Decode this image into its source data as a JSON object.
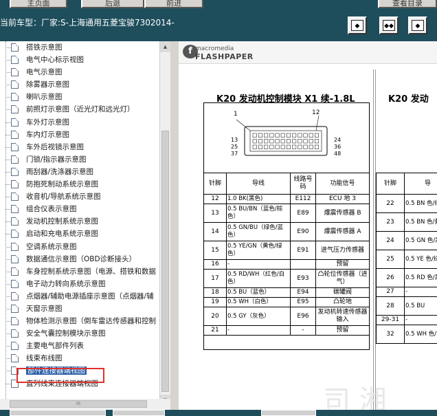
{
  "top_buttons": [
    "主页面",
    "后退",
    "前进",
    "查看目录"
  ],
  "car_model": "当前车型：厂家:S-上海通用五菱宝骏7302014-",
  "nav_buttons": [
    {
      "name": "single-page-icon",
      "glyph": "◆"
    },
    {
      "name": "fit-width-icon",
      "glyph": "◆◆"
    },
    {
      "name": "fit-page-icon",
      "glyph": "◆"
    }
  ],
  "tree": {
    "items": [
      "搭铁示意图",
      "电气中心标示视图",
      "电气示意图",
      "除雾器示意图",
      "喇叭示意图",
      "前照灯示意图（近光灯和远光灯）",
      "车外灯示意图",
      "车内灯示意图",
      "车外后视镜示意图",
      "门锁/指示器示意图",
      "雨刮器/洗涤器示意图",
      "防抱死制动系统示意图",
      "收音机/导航系统示意图",
      "组合仪表示意图",
      "发动机控制系统示意图",
      "启动和充电系统示意图",
      "空调系统示意图",
      "数据通信示意图（OBD诊断接头）",
      "车身控制系统示意图（电源、搭铁和数据",
      "电子动力转向系统示意图",
      "点烟器/辅助电源插座示意图（点烟器/辅",
      "天窗示意图",
      "物体检测示意图（倒车雷达传感器和控制",
      "安全气囊控制模块示意图",
      "主要电气部件列表",
      "线束布线图",
      "部件连接器端视图",
      "直列线束连接器端视图"
    ],
    "selected_index": 26
  },
  "flash": {
    "brand_top": "macromedia",
    "brand_bottom": "FLASHPAPER"
  },
  "doc": {
    "title_left": "K20 发动机控制模块 X1 续-1.8L",
    "title_right": "K20 发动",
    "connector_pins": {
      "top_left": "1",
      "top_right": "12",
      "left": [
        "13",
        "25",
        "37"
      ],
      "right": [
        "24",
        "36",
        "48"
      ]
    },
    "table_headers": [
      "针脚",
      "导线",
      "线路号码",
      "功能信号"
    ],
    "rows": [
      [
        "12",
        "1.0 BK(黑色)",
        "E112",
        "ECU 地 3"
      ],
      [
        "13",
        "0.5 BU/BN（蓝色/棕色）",
        "E89",
        "爆震传感器 B"
      ],
      [
        "14",
        "0.5 GN/BU（绿色/蓝色）",
        "E90",
        "爆震传感器 A"
      ],
      [
        "15",
        "0.5 YE/GN（黄色/绿色）",
        "E91",
        "进气压力传感器"
      ],
      [
        "16",
        "-",
        "",
        "预留"
      ],
      [
        "17",
        "0.5 RD/WH（红色/白色）",
        "E93",
        "凸轮位传感器（进气）"
      ],
      [
        "18",
        "0.5 BU（蓝色）",
        "E94",
        "碳罐阀"
      ],
      [
        "19",
        "0.5 WH（白色）",
        "E95",
        "凸轮地"
      ],
      [
        "20",
        "0.5 GY（灰色）",
        "E96",
        "发动机转速传感器输入"
      ],
      [
        "21",
        "-",
        "-",
        "预留"
      ]
    ],
    "right_headers": [
      "针脚",
      "导"
    ],
    "right_rows": [
      [
        "22",
        "0.5 BN 色/绿"
      ],
      [
        "23",
        "0.5 BN 色/黄"
      ],
      [
        "24",
        "0.5 GN 色/黑"
      ],
      [
        "25",
        "0.5 YE 色/绿"
      ],
      [
        "26",
        "0.5 RD 色/黑"
      ],
      [
        "27",
        "-"
      ],
      [
        "28",
        "0.5 BU"
      ],
      [
        "29-31",
        "-"
      ],
      [
        "32",
        "0.5 WH 色/黄"
      ]
    ],
    "watermark": "司 湘"
  },
  "hscroll_label": "III"
}
